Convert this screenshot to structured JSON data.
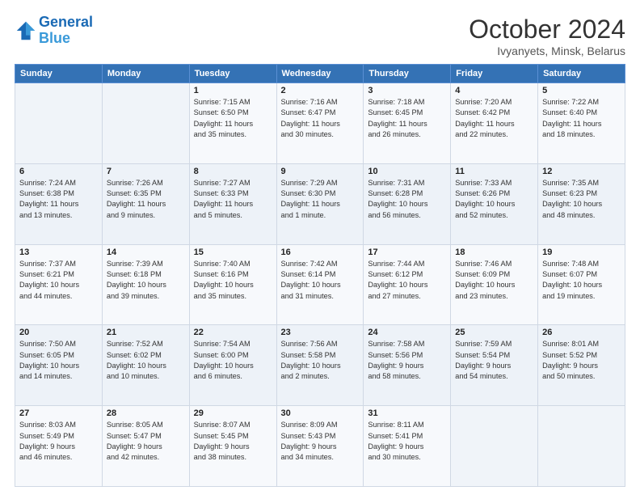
{
  "header": {
    "logo_line1": "General",
    "logo_line2": "Blue",
    "month_title": "October 2024",
    "location": "Ivyanyets, Minsk, Belarus"
  },
  "days_of_week": [
    "Sunday",
    "Monday",
    "Tuesday",
    "Wednesday",
    "Thursday",
    "Friday",
    "Saturday"
  ],
  "weeks": [
    [
      {
        "day": "",
        "info": ""
      },
      {
        "day": "",
        "info": ""
      },
      {
        "day": "1",
        "info": "Sunrise: 7:15 AM\nSunset: 6:50 PM\nDaylight: 11 hours\nand 35 minutes."
      },
      {
        "day": "2",
        "info": "Sunrise: 7:16 AM\nSunset: 6:47 PM\nDaylight: 11 hours\nand 30 minutes."
      },
      {
        "day": "3",
        "info": "Sunrise: 7:18 AM\nSunset: 6:45 PM\nDaylight: 11 hours\nand 26 minutes."
      },
      {
        "day": "4",
        "info": "Sunrise: 7:20 AM\nSunset: 6:42 PM\nDaylight: 11 hours\nand 22 minutes."
      },
      {
        "day": "5",
        "info": "Sunrise: 7:22 AM\nSunset: 6:40 PM\nDaylight: 11 hours\nand 18 minutes."
      }
    ],
    [
      {
        "day": "6",
        "info": "Sunrise: 7:24 AM\nSunset: 6:38 PM\nDaylight: 11 hours\nand 13 minutes."
      },
      {
        "day": "7",
        "info": "Sunrise: 7:26 AM\nSunset: 6:35 PM\nDaylight: 11 hours\nand 9 minutes."
      },
      {
        "day": "8",
        "info": "Sunrise: 7:27 AM\nSunset: 6:33 PM\nDaylight: 11 hours\nand 5 minutes."
      },
      {
        "day": "9",
        "info": "Sunrise: 7:29 AM\nSunset: 6:30 PM\nDaylight: 11 hours\nand 1 minute."
      },
      {
        "day": "10",
        "info": "Sunrise: 7:31 AM\nSunset: 6:28 PM\nDaylight: 10 hours\nand 56 minutes."
      },
      {
        "day": "11",
        "info": "Sunrise: 7:33 AM\nSunset: 6:26 PM\nDaylight: 10 hours\nand 52 minutes."
      },
      {
        "day": "12",
        "info": "Sunrise: 7:35 AM\nSunset: 6:23 PM\nDaylight: 10 hours\nand 48 minutes."
      }
    ],
    [
      {
        "day": "13",
        "info": "Sunrise: 7:37 AM\nSunset: 6:21 PM\nDaylight: 10 hours\nand 44 minutes."
      },
      {
        "day": "14",
        "info": "Sunrise: 7:39 AM\nSunset: 6:18 PM\nDaylight: 10 hours\nand 39 minutes."
      },
      {
        "day": "15",
        "info": "Sunrise: 7:40 AM\nSunset: 6:16 PM\nDaylight: 10 hours\nand 35 minutes."
      },
      {
        "day": "16",
        "info": "Sunrise: 7:42 AM\nSunset: 6:14 PM\nDaylight: 10 hours\nand 31 minutes."
      },
      {
        "day": "17",
        "info": "Sunrise: 7:44 AM\nSunset: 6:12 PM\nDaylight: 10 hours\nand 27 minutes."
      },
      {
        "day": "18",
        "info": "Sunrise: 7:46 AM\nSunset: 6:09 PM\nDaylight: 10 hours\nand 23 minutes."
      },
      {
        "day": "19",
        "info": "Sunrise: 7:48 AM\nSunset: 6:07 PM\nDaylight: 10 hours\nand 19 minutes."
      }
    ],
    [
      {
        "day": "20",
        "info": "Sunrise: 7:50 AM\nSunset: 6:05 PM\nDaylight: 10 hours\nand 14 minutes."
      },
      {
        "day": "21",
        "info": "Sunrise: 7:52 AM\nSunset: 6:02 PM\nDaylight: 10 hours\nand 10 minutes."
      },
      {
        "day": "22",
        "info": "Sunrise: 7:54 AM\nSunset: 6:00 PM\nDaylight: 10 hours\nand 6 minutes."
      },
      {
        "day": "23",
        "info": "Sunrise: 7:56 AM\nSunset: 5:58 PM\nDaylight: 10 hours\nand 2 minutes."
      },
      {
        "day": "24",
        "info": "Sunrise: 7:58 AM\nSunset: 5:56 PM\nDaylight: 9 hours\nand 58 minutes."
      },
      {
        "day": "25",
        "info": "Sunrise: 7:59 AM\nSunset: 5:54 PM\nDaylight: 9 hours\nand 54 minutes."
      },
      {
        "day": "26",
        "info": "Sunrise: 8:01 AM\nSunset: 5:52 PM\nDaylight: 9 hours\nand 50 minutes."
      }
    ],
    [
      {
        "day": "27",
        "info": "Sunrise: 8:03 AM\nSunset: 5:49 PM\nDaylight: 9 hours\nand 46 minutes."
      },
      {
        "day": "28",
        "info": "Sunrise: 8:05 AM\nSunset: 5:47 PM\nDaylight: 9 hours\nand 42 minutes."
      },
      {
        "day": "29",
        "info": "Sunrise: 8:07 AM\nSunset: 5:45 PM\nDaylight: 9 hours\nand 38 minutes."
      },
      {
        "day": "30",
        "info": "Sunrise: 8:09 AM\nSunset: 5:43 PM\nDaylight: 9 hours\nand 34 minutes."
      },
      {
        "day": "31",
        "info": "Sunrise: 8:11 AM\nSunset: 5:41 PM\nDaylight: 9 hours\nand 30 minutes."
      },
      {
        "day": "",
        "info": ""
      },
      {
        "day": "",
        "info": ""
      }
    ]
  ]
}
